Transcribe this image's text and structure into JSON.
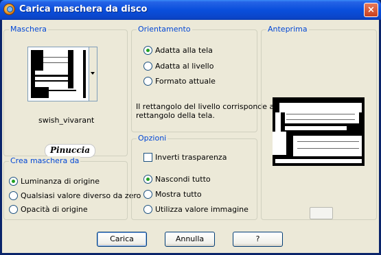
{
  "window": {
    "title": "Carica maschera da disco",
    "close_label": "×"
  },
  "mask_group": {
    "legend": "Maschera",
    "mask_name": "swish_vivarant",
    "logo_text": "Pinuccia"
  },
  "orientation_group": {
    "legend": "Orientamento",
    "options": [
      {
        "label": "Adatta alla tela",
        "selected": true
      },
      {
        "label": "Adatta al livello",
        "selected": false
      },
      {
        "label": "Formato attuale",
        "selected": false
      }
    ],
    "note_line1": "Il rettangolo del livello corrisponde al",
    "note_line2": "rettangolo della tela."
  },
  "preview_group": {
    "legend": "Anteprima"
  },
  "create_group": {
    "legend": "Crea maschera da",
    "options": [
      {
        "label": "Luminanza di origine",
        "selected": true
      },
      {
        "label": "Qualsiasi valore diverso da zero",
        "selected": false
      },
      {
        "label": "Opacità di origine",
        "selected": false
      }
    ]
  },
  "options_group": {
    "legend": "Opzioni",
    "invert_label": "Inverti trasparenza",
    "invert_checked": false,
    "options": [
      {
        "label": "Nascondi tutto",
        "selected": true
      },
      {
        "label": "Mostra tutto",
        "selected": false
      },
      {
        "label": "Utilizza valore immagine",
        "selected": false
      }
    ]
  },
  "buttons": {
    "load": "Carica",
    "cancel": "Annulla",
    "help": "?"
  },
  "colors": {
    "title_bar": "#0a4fdc",
    "legend_text": "#0046d5",
    "radio_dot": "#21a121",
    "dialog_bg": "#ece9d8"
  }
}
